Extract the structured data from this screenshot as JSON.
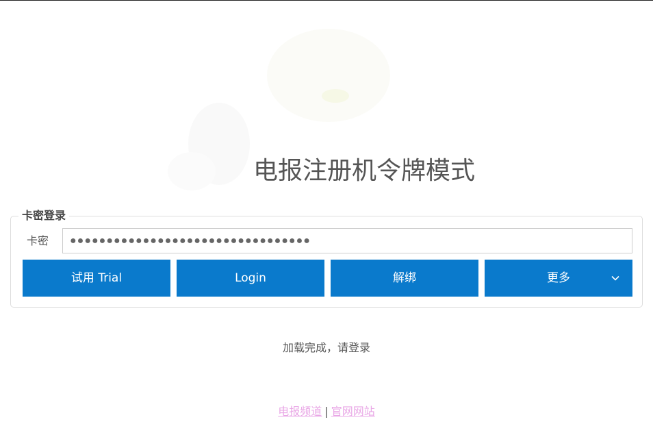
{
  "page": {
    "title": "电报注册机令牌模式"
  },
  "login": {
    "legend": "卡密登录",
    "field_label": "卡密",
    "card_value": "●●●●●●●●●●●●●●●●●●●●●●●●●●●●●●●●●"
  },
  "buttons": {
    "trial": "试用 Trial",
    "login": "Login",
    "unbind": "解绑",
    "more": "更多"
  },
  "status": "加载完成，请登录",
  "footer": {
    "link1": "电报频道",
    "separator": "|",
    "link2": "官网网站"
  },
  "colors": {
    "button": "#0a7acc",
    "link": "#e9a7e6"
  },
  "icons": {
    "more_dropdown": "chevron-down-icon"
  }
}
